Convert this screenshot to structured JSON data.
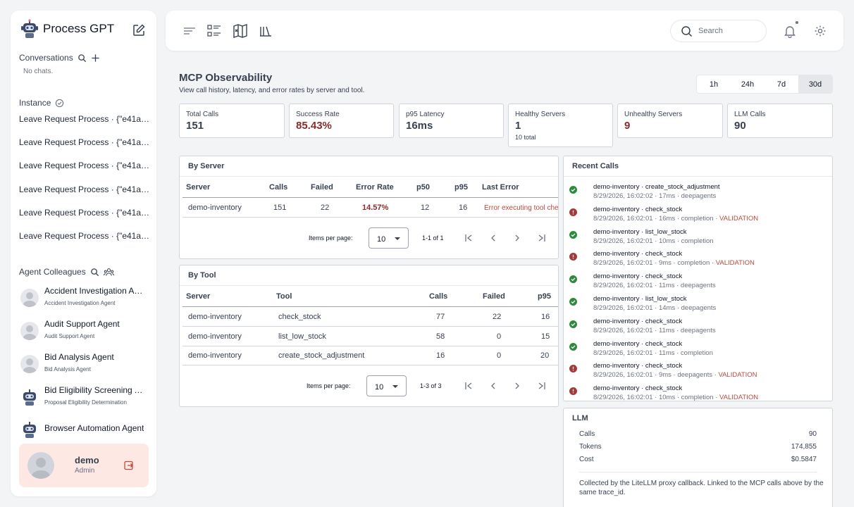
{
  "app": {
    "title": "Process GPT"
  },
  "sidebar": {
    "conversations_label": "Conversations",
    "no_chats": "No chats.",
    "instance_label": "Instance",
    "instances": [
      "Leave Request Process · {\"e41a53...",
      "Leave Request Process · {\"e41a53...",
      "Leave Request Process · {\"e41a53...",
      "Leave Request Process · {\"e41a53...",
      "Leave Request Process · {\"e41a53...",
      "Leave Request Process · {\"e41a53..."
    ],
    "agents_label": "Agent Colleagues",
    "agents": [
      {
        "name": "Accident Investigation Agent",
        "sub": "Accident Investigation Agent"
      },
      {
        "name": "Audit Support Agent",
        "sub": "Audit Support Agent"
      },
      {
        "name": "Bid Analysis Agent",
        "sub": "Bid Analysis Agent"
      },
      {
        "name": "Bid Eligibility Screening Agent",
        "sub": "Proposal Eligibility Determination"
      },
      {
        "name": "Browser Automation Agent",
        "sub": ""
      }
    ],
    "user": {
      "name": "demo",
      "role": "Admin"
    }
  },
  "topbar": {
    "search_placeholder": "Search"
  },
  "main": {
    "title": "MCP Observability",
    "subtitle": "View call history, latency, and error rates by server and tool.",
    "ranges": [
      "1h",
      "24h",
      "7d",
      "30d"
    ],
    "active_range": "30d",
    "kpis": [
      {
        "label": "Total Calls",
        "value": "151",
        "extra": ""
      },
      {
        "label": "Success Rate",
        "value": "85.43%",
        "extra": ""
      },
      {
        "label": "p95 Latency",
        "value": "16ms",
        "extra": ""
      },
      {
        "label": "Healthy Servers",
        "value": "1",
        "extra": "10 total"
      },
      {
        "label": "Unhealthy Servers",
        "value": "9",
        "extra": ""
      },
      {
        "label": "LLM Calls",
        "value": "90",
        "extra": ""
      }
    ],
    "by_server": {
      "title": "By Server",
      "headers": [
        "Server",
        "Calls",
        "Failed",
        "Error Rate",
        "p50",
        "p95",
        "Last Error"
      ],
      "rows": [
        {
          "server": "demo-inventory",
          "calls": "151",
          "failed": "22",
          "error_rate": "14.57%",
          "p50": "12",
          "p95": "16",
          "last_error": "Error executing tool che"
        }
      ],
      "items_per_page_label": "Items per page:",
      "items_per_page": "10",
      "range": "1-1 of 1"
    },
    "by_tool": {
      "title": "By Tool",
      "headers": [
        "Server",
        "Tool",
        "Calls",
        "Failed",
        "p95"
      ],
      "rows": [
        {
          "server": "demo-inventory",
          "tool": "check_stock",
          "calls": "77",
          "failed": "22",
          "p95": "16"
        },
        {
          "server": "demo-inventory",
          "tool": "list_low_stock",
          "calls": "58",
          "failed": "0",
          "p95": "15"
        },
        {
          "server": "demo-inventory",
          "tool": "create_stock_adjustment",
          "calls": "16",
          "failed": "0",
          "p95": "20"
        }
      ],
      "items_per_page_label": "Items per page:",
      "items_per_page": "10",
      "range": "1-3 of 3"
    },
    "recent_calls": {
      "title": "Recent Calls",
      "items": [
        {
          "ok": true,
          "title": "demo-inventory · create_stock_adjustment",
          "meta": "8/29/2026, 16:02:02 · 17ms · deepagents",
          "tag": ""
        },
        {
          "ok": false,
          "title": "demo-inventory · check_stock",
          "meta": "8/29/2026, 16:02:01 · 16ms · completion · ",
          "tag": "VALIDATION"
        },
        {
          "ok": true,
          "title": "demo-inventory · list_low_stock",
          "meta": "8/29/2026, 16:02:01 · 10ms · completion",
          "tag": ""
        },
        {
          "ok": false,
          "title": "demo-inventory · check_stock",
          "meta": "8/29/2026, 16:02:01 · 9ms · completion · ",
          "tag": "VALIDATION"
        },
        {
          "ok": true,
          "title": "demo-inventory · check_stock",
          "meta": "8/29/2026, 16:02:01 · 11ms · deepagents",
          "tag": ""
        },
        {
          "ok": true,
          "title": "demo-inventory · list_low_stock",
          "meta": "8/29/2026, 16:02:01 · 14ms · deepagents",
          "tag": ""
        },
        {
          "ok": true,
          "title": "demo-inventory · check_stock",
          "meta": "8/29/2026, 16:02:01 · 11ms · deepagents",
          "tag": ""
        },
        {
          "ok": true,
          "title": "demo-inventory · check_stock",
          "meta": "8/29/2026, 16:02:01 · 11ms · completion",
          "tag": ""
        },
        {
          "ok": false,
          "title": "demo-inventory · check_stock",
          "meta": "8/29/2026, 16:02:01 · 9ms · deepagents · ",
          "tag": "VALIDATION"
        },
        {
          "ok": false,
          "title": "demo-inventory · check_stock",
          "meta": "8/29/2026, 16:02:01 · 10ms · completion · ",
          "tag": "VALIDATION"
        }
      ]
    },
    "llm": {
      "title": "LLM",
      "rows": [
        {
          "label": "Calls",
          "value": "90"
        },
        {
          "label": "Tokens",
          "value": "174,855"
        },
        {
          "label": "Cost",
          "value": "$0.5847"
        }
      ],
      "note": "Collected by the LiteLLM proxy callback. Linked to the MCP calls above by the same trace_id."
    }
  }
}
